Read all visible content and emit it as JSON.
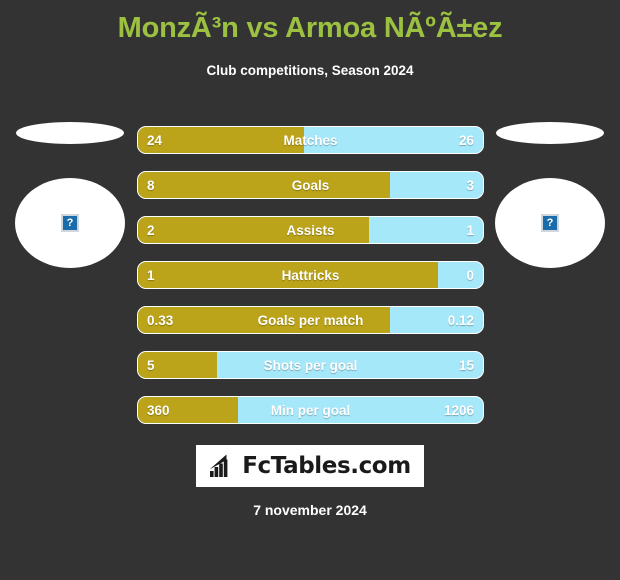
{
  "header": {
    "title": "MonzÃ³n vs Armoa NÃºÃ±ez",
    "subtitle": "Club competitions, Season 2024"
  },
  "colors": {
    "background": "#333333",
    "title": "#9cc141",
    "home_bar": "#BCA41A",
    "away_bar": "#A5E8FA",
    "text": "#ffffff"
  },
  "players": {
    "home": {
      "photo_alt": "?",
      "photo_status": "missing-image"
    },
    "away": {
      "photo_alt": "?",
      "photo_status": "missing-image"
    }
  },
  "chart_data": {
    "type": "bar",
    "title": "MonzÃ³n vs Armoa NÃºÃ±ez",
    "subtitle": "Club competitions, Season 2024",
    "orientation": "horizontal-diverging",
    "series": [
      {
        "name": "MonzÃ³n",
        "side": "left",
        "color": "#BCA41A"
      },
      {
        "name": "Armoa NÃºÃ±ez",
        "side": "right",
        "color": "#A5E8FA"
      }
    ],
    "categories": [
      "Matches",
      "Goals",
      "Assists",
      "Hattricks",
      "Goals per match",
      "Shots per goal",
      "Min per goal"
    ],
    "rows": [
      {
        "label": "Matches",
        "home": "24",
        "away": "26",
        "home_pct": 48
      },
      {
        "label": "Goals",
        "home": "8",
        "away": "3",
        "home_pct": 73
      },
      {
        "label": "Assists",
        "home": "2",
        "away": "1",
        "home_pct": 67
      },
      {
        "label": "Hattricks",
        "home": "1",
        "away": "0",
        "home_pct": 87
      },
      {
        "label": "Goals per match",
        "home": "0.33",
        "away": "0.12",
        "home_pct": 73
      },
      {
        "label": "Shots per goal",
        "home": "5",
        "away": "15",
        "home_pct": 23
      },
      {
        "label": "Min per goal",
        "home": "360",
        "away": "1206",
        "home_pct": 29
      }
    ]
  },
  "logo": {
    "text": "FcTables.com",
    "icon": "bar-chart-growth-icon"
  },
  "footer": {
    "date": "7 november 2024"
  }
}
